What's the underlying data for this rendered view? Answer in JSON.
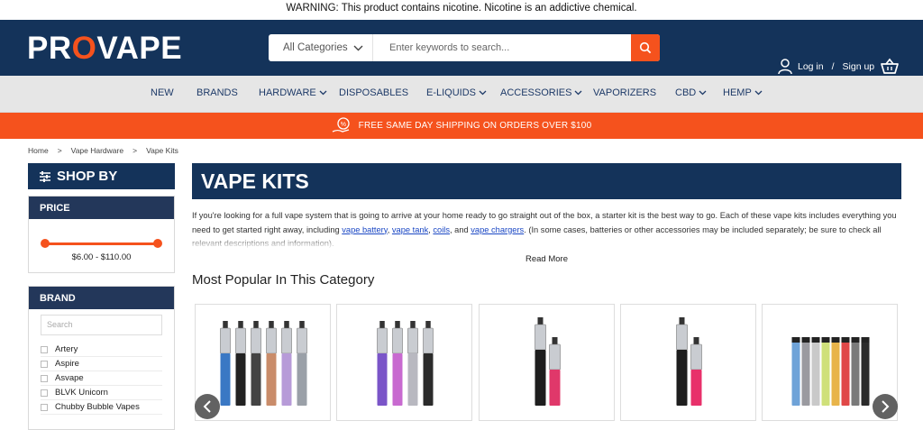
{
  "warning": "WARNING: This product contains nicotine. Nicotine is an addictive chemical.",
  "brand": {
    "logo_pre": "PR",
    "logo_o": "O",
    "logo_post": "VAPE",
    "accent": "#f5521d",
    "navy": "#14335a"
  },
  "search": {
    "category": "All Categories",
    "placeholder": "Enter keywords to search..."
  },
  "account": {
    "login": "Log in",
    "sep": "/",
    "signup": "Sign up"
  },
  "nav": [
    {
      "label": "NEW",
      "caret": false
    },
    {
      "label": "BRANDS",
      "caret": false
    },
    {
      "label": "HARDWARE",
      "caret": true
    },
    {
      "label": "DISPOSABLES",
      "caret": false
    },
    {
      "label": "E-LIQUIDS",
      "caret": true
    },
    {
      "label": "ACCESSORIES",
      "caret": true
    },
    {
      "label": "VAPORIZERS",
      "caret": false
    },
    {
      "label": "CBD",
      "caret": true
    },
    {
      "label": "HEMP",
      "caret": true
    }
  ],
  "shipping": "FREE SAME DAY SHIPPING ON ORDERS OVER $100",
  "breadcrumb": [
    "Home",
    ">",
    "Vape Hardware",
    ">",
    "Vape Kits"
  ],
  "sidebar": {
    "shop_by": "SHOP BY",
    "price_title": "PRICE",
    "price_range": "$6.00 - $110.00",
    "brand_title": "BRAND",
    "brand_search": "Search",
    "brands": [
      "Artery",
      "Aspire",
      "Asvape",
      "BLVK Unicorn",
      "Chubby Bubble Vapes"
    ]
  },
  "main": {
    "title": "VAPE KITS",
    "desc_1": "If you're looking for a full vape system that is going to arrive at your home ready to go straight out of the box, a starter kit is the best way to go. Each of these vape kits includes everything you need to get started right away, including ",
    "link_battery": "vape battery",
    "comma1": ", ",
    "link_tank": "vape tank",
    "comma2": ", ",
    "link_coils": "coils",
    "and": ", and ",
    "link_chargers": "vape chargers",
    "desc_2": ". (In some cases, batteries or other accessories may be included separately; be sure to check all relevant descriptions and information).",
    "read_more": "Read More",
    "popular": "Most Popular In This Category"
  },
  "products": [
    {
      "name": "kit-multicolor-tubes",
      "colors": [
        "#3a78c4",
        "#222",
        "#444",
        "#c98c6a",
        "#b79bd8",
        "#9aa0a8"
      ]
    },
    {
      "name": "kit-rainbow-tubes",
      "colors": [
        "#7a55c8",
        "#c86ad0",
        "#b8b8c0",
        "#2b2b2b"
      ]
    },
    {
      "name": "kit-black-pink-pair",
      "colors": [
        "#1e1e1e",
        "#e0386a"
      ]
    },
    {
      "name": "kit-black-pink-slim",
      "colors": [
        "#1e1e1e",
        "#e8306a"
      ]
    },
    {
      "name": "kit-color-batteries",
      "colors": [
        "#6fa3d8",
        "#9a9aa0",
        "#c9c9c9",
        "#cfe07a",
        "#e8b44a",
        "#e04848",
        "#7a7a7a",
        "#2b2b2b"
      ]
    }
  ]
}
